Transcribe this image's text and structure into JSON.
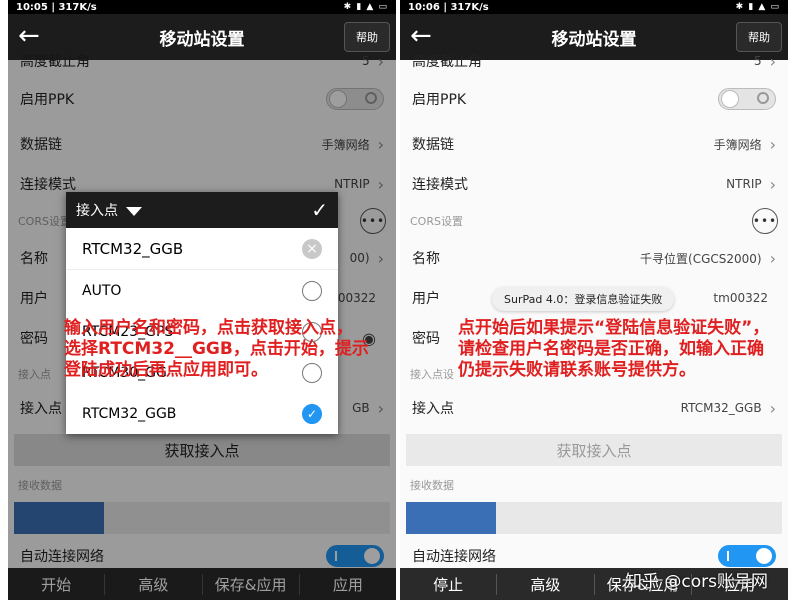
{
  "left": {
    "status": {
      "time": "10:05",
      "speed": "317K/s",
      "icons": "✱ ▮ ▲ ▭"
    },
    "appbar": {
      "back_icon": "←",
      "title": "移动站设置",
      "help": "帮助"
    },
    "rows": {
      "cutoff_label": "高度截止角",
      "cutoff_value": "5",
      "ppk_label": "启用PPK",
      "datalink_label": "数据链",
      "datalink_value": "手簿网络",
      "connmode_label": "连接模式",
      "connmode_value": "NTRIP",
      "cors_section": "CORS设置",
      "name_label": "名称",
      "name_value_partial": "00)",
      "user_label": "用户",
      "user_value_partial": "00322",
      "pwd_label": "密码",
      "mount_section": "接入点",
      "mount_label": "接入点",
      "mount_value_partial": "GB"
    },
    "fetch_button": "获取接入点",
    "receive_section": "接收数据",
    "receive_progress": 0.24,
    "auto_label": "自动连接网络",
    "bottom": [
      "开始",
      "高级",
      "保存&应用",
      "应用"
    ],
    "dialog": {
      "title": "接入点",
      "confirm_icon": "✓",
      "input_value": "RTCM32_GGB",
      "clear_icon": "×",
      "options": [
        {
          "label": "AUTO",
          "selected": false
        },
        {
          "label": "RTCM23_GPS",
          "selected": false
        },
        {
          "label": "RTCM30_GG",
          "selected": false
        },
        {
          "label": "RTCM32_GGB",
          "selected": true
        }
      ],
      "selected_icon": "✓"
    },
    "annotation": "输入用户名和密码，点击获取接入点，选择RTCM32__GGB，点击开始，提示登陆成功后再点应用即可。"
  },
  "right": {
    "status": {
      "time": "10:06",
      "speed": "317K/s",
      "icons": "✱ ▮ ▲ ▭"
    },
    "appbar": {
      "back_icon": "←",
      "title": "移动站设置",
      "help": "帮助"
    },
    "rows": {
      "cutoff_label": "高度截止角",
      "cutoff_value": "5",
      "ppk_label": "启用PPK",
      "datalink_label": "数据链",
      "datalink_value": "手簿网络",
      "connmode_label": "连接模式",
      "connmode_value": "NTRIP",
      "cors_section": "CORS设置",
      "name_label": "名称",
      "name_value": "千寻位置(CGCS2000)",
      "user_label": "用户",
      "user_value_partial": "tm00322",
      "pwd_label": "密码",
      "mount_section": "接入点设",
      "mount_label": "接入点",
      "mount_value": "RTCM32_GGB"
    },
    "fetch_button": "获取接入点",
    "receive_section": "接收数据",
    "receive_progress": 0.24,
    "auto_label": "自动连接网络",
    "toast": "SurPad 4.0：登录信息验证失败",
    "bottom": [
      "停止",
      "高级",
      "保存&应用",
      "应用"
    ],
    "annotation": "点开始后如果提示“登陆信息验证失败”，请检查用户名密码是否正确，如输入正确仍提示失败请联系账号提供方。",
    "watermark": "知乎 @cors账号网"
  },
  "icons": {
    "chevron": "›",
    "more": "•••",
    "eye": "◉"
  },
  "colors": {
    "accent": "#2196f3",
    "annotation": "#e02020",
    "progress": "#3a6fb5"
  }
}
